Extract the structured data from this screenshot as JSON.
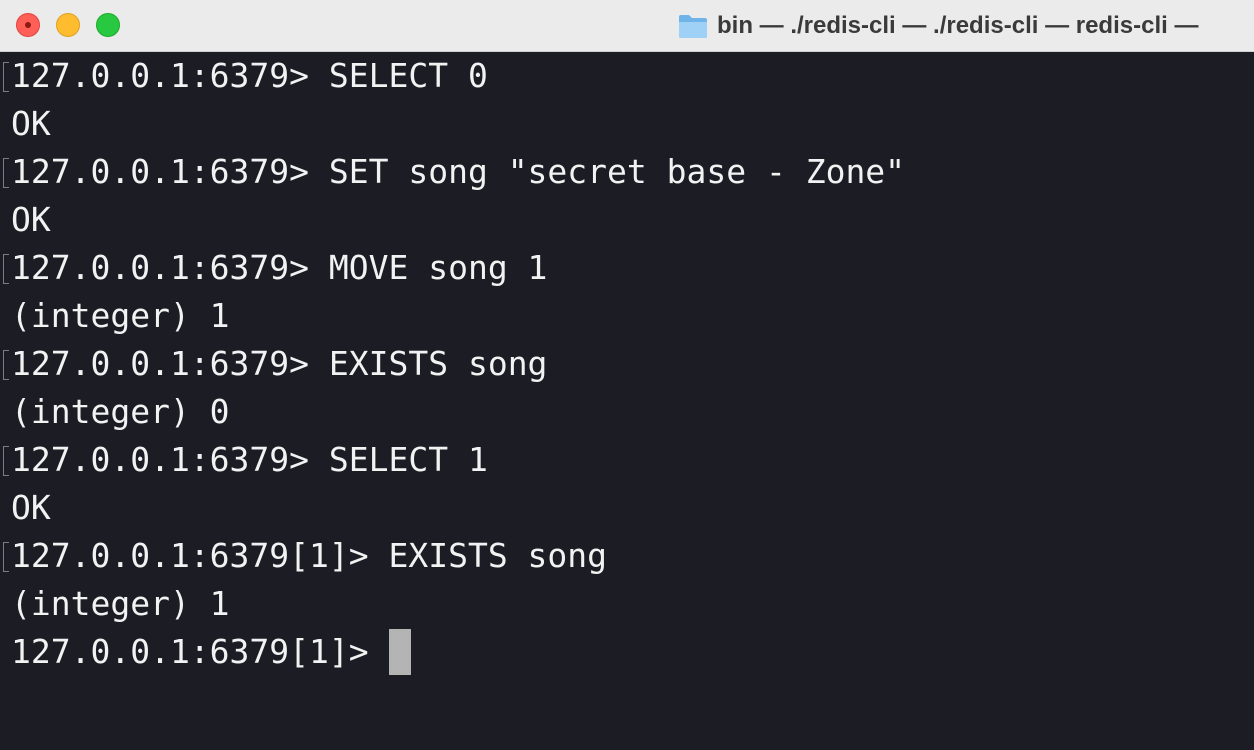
{
  "window": {
    "title": "bin — ./redis-cli — ./redis-cli — redis-cli —",
    "title_icon": "folder-icon",
    "colors": {
      "background": "#1b1c24",
      "text": "#f2f2f2",
      "titlebar": "#ebebeb",
      "close": "#ff5f57",
      "minimize": "#febc2e",
      "maximize": "#28c840",
      "cursor": "#b4b4b4"
    }
  },
  "terminal": {
    "lines": [
      {
        "text": "127.0.0.1:6379> SELECT 0",
        "kind": "command"
      },
      {
        "text": "OK",
        "kind": "output"
      },
      {
        "text": "127.0.0.1:6379> SET song \"secret base - Zone\"",
        "kind": "command"
      },
      {
        "text": "OK",
        "kind": "output"
      },
      {
        "text": "127.0.0.1:6379> MOVE song 1",
        "kind": "command"
      },
      {
        "text": "(integer) 1",
        "kind": "output"
      },
      {
        "text": "127.0.0.1:6379> EXISTS song",
        "kind": "command"
      },
      {
        "text": "(integer) 0",
        "kind": "output"
      },
      {
        "text": "127.0.0.1:6379> SELECT 1",
        "kind": "command"
      },
      {
        "text": "OK",
        "kind": "output"
      },
      {
        "text": "127.0.0.1:6379[1]> EXISTS song",
        "kind": "command"
      },
      {
        "text": "(integer) 1",
        "kind": "output"
      }
    ],
    "prompt": "127.0.0.1:6379[1]>"
  }
}
